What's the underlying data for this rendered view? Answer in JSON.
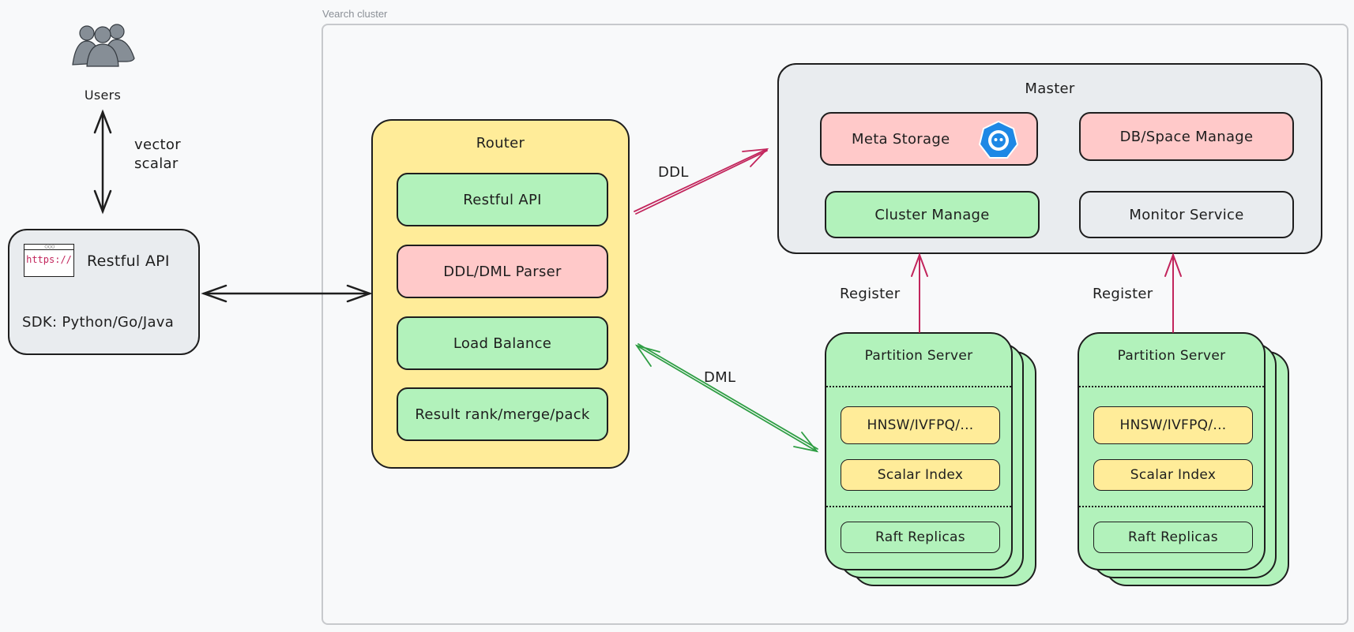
{
  "users": {
    "label": "Users",
    "icon": "users-group-icon",
    "edge_label_lines": [
      "vector",
      "scalar"
    ]
  },
  "client": {
    "icon": "browser-https-icon",
    "icon_text": "https://",
    "title": "Restful API",
    "sdk": "SDK: Python/Go/Java"
  },
  "cluster": {
    "label": "Vearch cluster"
  },
  "router": {
    "title": "Router",
    "items": [
      {
        "label": "Restful API",
        "color": "#b2f2bb"
      },
      {
        "label": "DDL/DML Parser",
        "color": "#ffc9c9"
      },
      {
        "label": "Load Balance",
        "color": "#b2f2bb"
      },
      {
        "label": "Result rank/merge/pack",
        "color": "#b2f2bb"
      }
    ]
  },
  "master": {
    "title": "Master",
    "items": [
      {
        "label": "Meta Storage",
        "color": "#ffc9c9",
        "icon": "etcd-icon"
      },
      {
        "label": "DB/Space Manage",
        "color": "#ffc9c9"
      },
      {
        "label": "Cluster Manage",
        "color": "#b2f2bb"
      },
      {
        "label": "Monitor Service",
        "color": "#e9ecef"
      }
    ]
  },
  "edges": {
    "ddl": "DDL",
    "dml": "DML",
    "register_left": "Register",
    "register_right": "Register"
  },
  "partition_servers": [
    {
      "title": "Partition Server",
      "vector_index": "HNSW/IVFPQ/...",
      "scalar_index": "Scalar Index",
      "replicas": "Raft Replicas"
    },
    {
      "title": "Partition Server",
      "vector_index": "HNSW/IVFPQ/...",
      "scalar_index": "Scalar Index",
      "replicas": "Raft Replicas"
    }
  ],
  "colors": {
    "ddl_arrow": "#c2255c",
    "dml_arrow": "#2f9e44",
    "register_arrow": "#c2255c",
    "component_green": "#b2f2bb",
    "component_red": "#ffc9c9",
    "component_yellow": "#ffec99",
    "component_gray": "#e9ecef"
  }
}
